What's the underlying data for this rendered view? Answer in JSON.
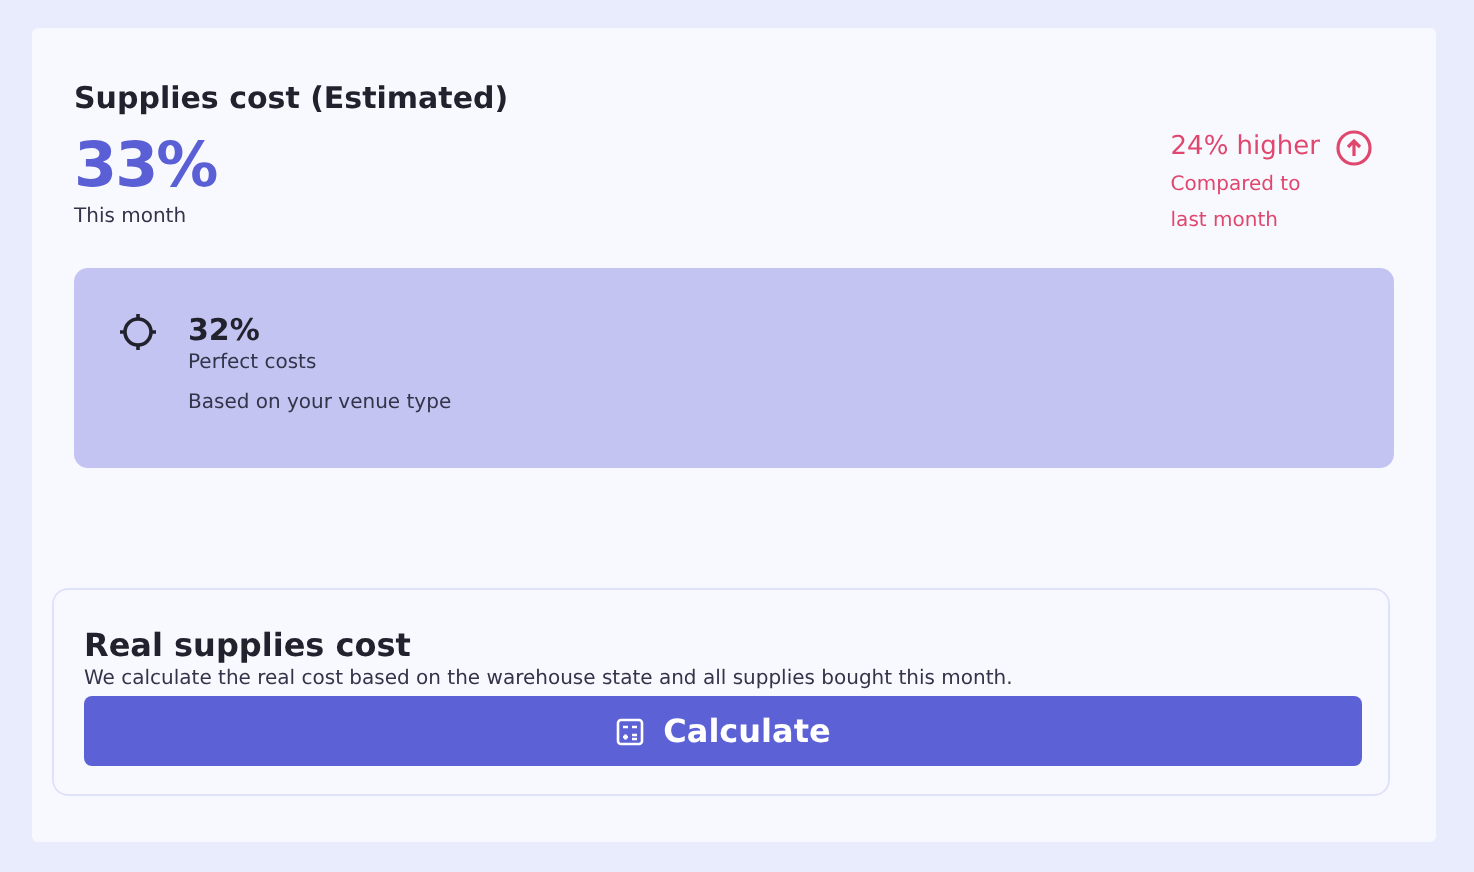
{
  "title": "Supplies cost (Estimated)",
  "value": "33%",
  "period": "This month",
  "trend": {
    "kind": "up",
    "label": "24% higher",
    "note_lines": [
      "Compared to",
      "last month"
    ]
  },
  "target": {
    "value": "32%",
    "label": "Perfect costs",
    "note": "Based on your venue type"
  },
  "real_cost": {
    "title": "Real supplies cost",
    "description": "We calculate the real cost based on the warehouse state and all supplies bought this month.",
    "button": "Calculate"
  }
}
